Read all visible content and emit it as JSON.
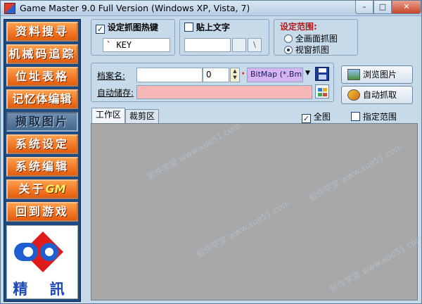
{
  "window": {
    "title": "Game Master 9.0 Full Version (Windows XP, Vista, 7)",
    "controls": {
      "minimize": "–",
      "maximize": "□",
      "close": "✕"
    }
  },
  "sidebar": {
    "items": [
      {
        "label": "资料搜寻"
      },
      {
        "label": "机械码追踪"
      },
      {
        "label": "位址表格"
      },
      {
        "label": "记忆体编辑"
      },
      {
        "label": "撷取图片"
      },
      {
        "label": "系统设定"
      },
      {
        "label": "系统编辑"
      },
      {
        "label_prefix": "关于",
        "label_logo": "GM"
      },
      {
        "label": "回到游戏"
      }
    ],
    "logo": {
      "text": "精 訊"
    }
  },
  "hotkey": {
    "checkbox_label": "设定抓图热键",
    "checked": true,
    "value": "` KEY"
  },
  "paste_text": {
    "checkbox_label": "贴上文字",
    "checked": false,
    "value": "",
    "button_1": "",
    "button_2": "\\"
  },
  "range": {
    "title": "设定范围:",
    "option_full": "全画面抓图",
    "option_window": "视窗抓图",
    "selected": "window"
  },
  "file": {
    "name_label": "档案名:",
    "name_value": "",
    "counter": "0",
    "format": "BitMap (*.Bmp)",
    "autosave_label": "自动储存:",
    "autosave_value": ""
  },
  "actions": {
    "browse": "浏览图片",
    "auto_capture": "自动抓取"
  },
  "tabs": {
    "work": "工作区",
    "crop": "裁剪区"
  },
  "options": {
    "full_label": "全图",
    "full_checked": true,
    "range_label": "指定范围",
    "range_checked": false
  },
  "watermark": "软件学堂 www.xue51.com",
  "colors": {
    "sidebar_orange": "#e55a0a",
    "sidebar_active": "#44678c",
    "autosave_pink": "#f7b6b8",
    "format_purple": "#d6b4f1",
    "work_gray": "#a8a8a8"
  }
}
